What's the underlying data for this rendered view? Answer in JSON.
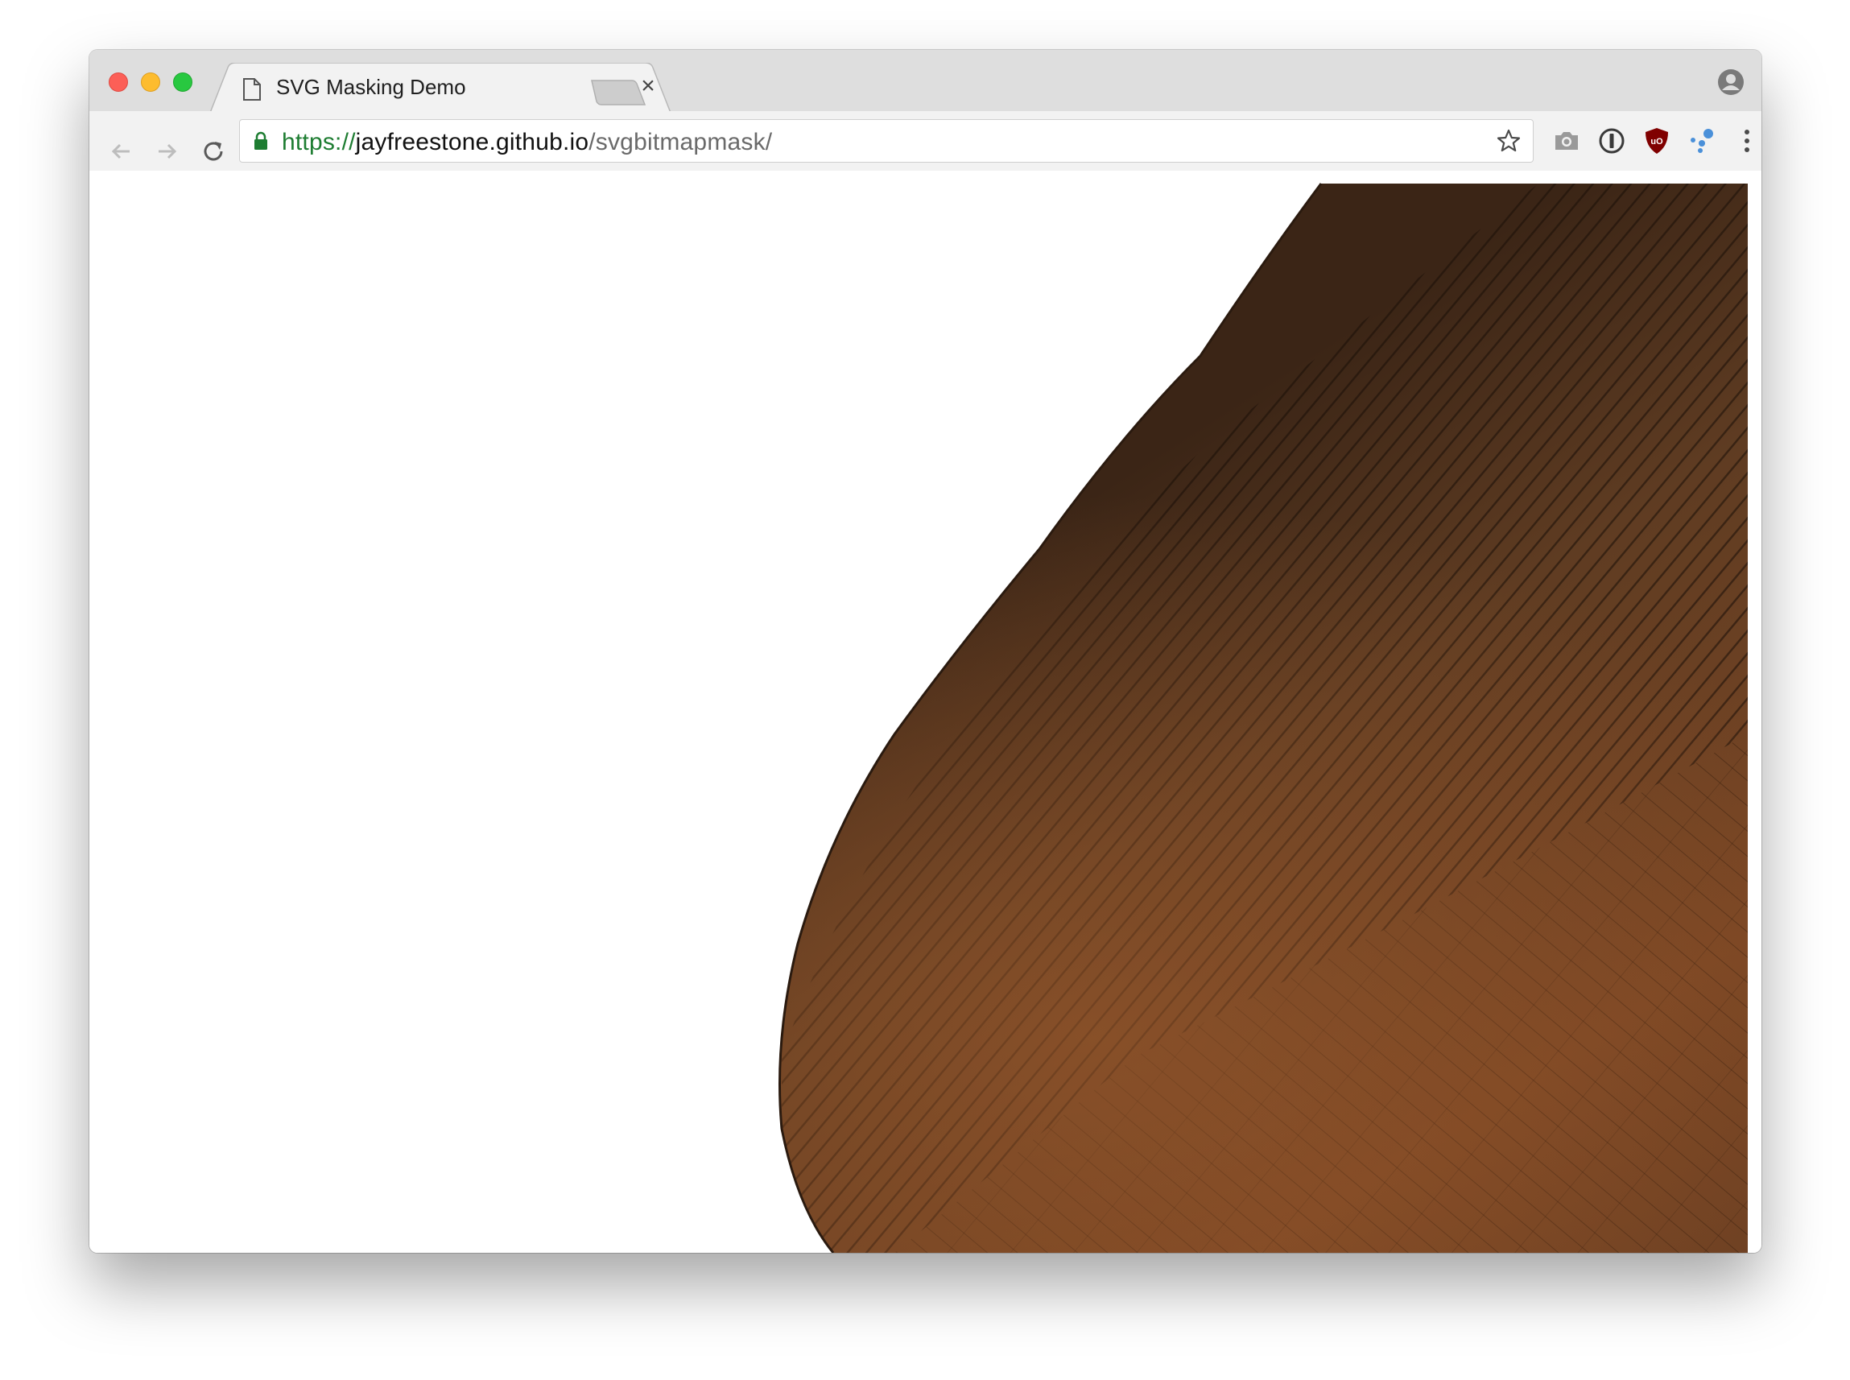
{
  "browser": {
    "tab": {
      "title": "SVG Masking Demo",
      "close_glyph": "×"
    },
    "address_bar": {
      "scheme": "https://",
      "host": "jayfreestone.github.io",
      "path": "/svgbitmapmask/"
    },
    "icons": {
      "back": "back-arrow-icon",
      "forward": "forward-arrow-icon",
      "reload": "reload-icon",
      "lock": "lock-icon",
      "bookmark": "star-icon",
      "extensions": [
        "camera-icon",
        "1password-icon",
        "ublock-origin-icon",
        "dots-extension-icon"
      ],
      "menu": "kebab-menu-icon",
      "profile": "profile-icon"
    }
  },
  "colors": {
    "titlebar": "#dedede",
    "toolbar": "#f2f2f2",
    "url_scheme": "#1e7d32",
    "wood_dark": "#2b1a10",
    "wood_mid": "#5a3a22",
    "wood_warm": "#8a4f26"
  }
}
